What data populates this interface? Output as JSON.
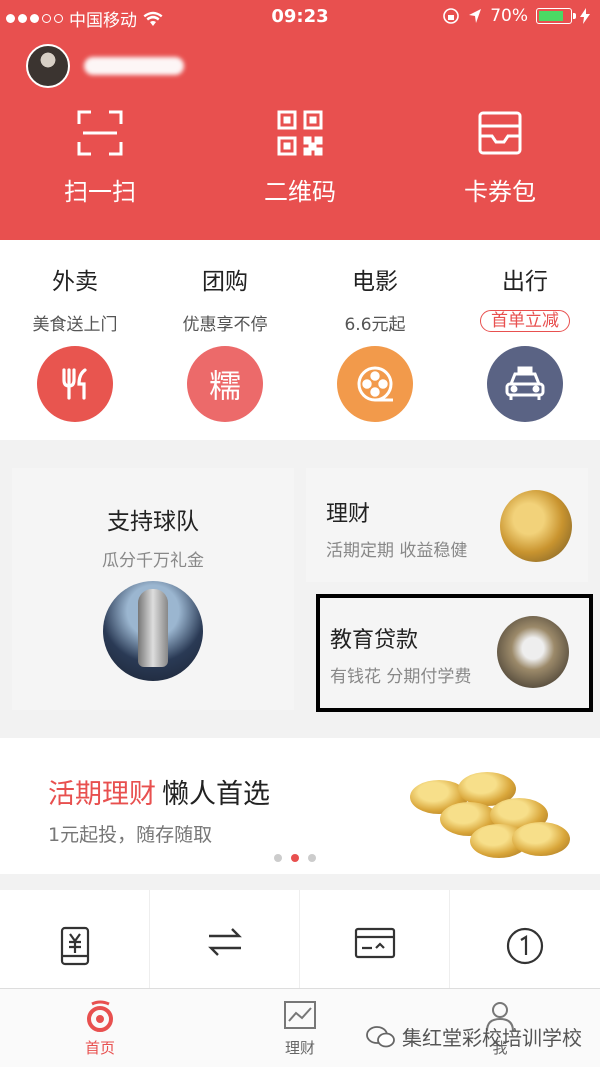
{
  "status_bar": {
    "carrier": "中国移动",
    "time": "09:23",
    "battery_percent": "70%"
  },
  "quick_actions": [
    {
      "label": "扫一扫",
      "icon": "scan-icon"
    },
    {
      "label": "二维码",
      "icon": "qrcode-icon"
    },
    {
      "label": "卡券包",
      "icon": "wallet-icon"
    }
  ],
  "categories": [
    {
      "title": "外卖",
      "subtitle": "美食送上门",
      "icon": "fork-knife-icon",
      "color": "#e8554f"
    },
    {
      "title": "团购",
      "subtitle": "优惠享不停",
      "icon": "nuo-icon",
      "icon_text": "糯",
      "color": "#ec6a6a"
    },
    {
      "title": "电影",
      "subtitle": "6.6元起",
      "icon": "film-reel-icon",
      "color": "#f29a4b"
    },
    {
      "title": "出行",
      "subtitle": "首单立减",
      "icon": "taxi-icon",
      "color": "#5a6384"
    }
  ],
  "promo": {
    "team": {
      "title": "支持球队",
      "subtitle": "瓜分千万礼金"
    },
    "finance": {
      "title": "理财",
      "subtitle": "活期定期 收益稳健"
    },
    "education": {
      "title": "教育贷款",
      "subtitle": "有钱花 分期付学费"
    }
  },
  "banner": {
    "highlight": "活期理财",
    "headline": "懒人首选",
    "subtext": "1元起投，随存随取"
  },
  "tabbar": {
    "home": "首页",
    "finance": "理财",
    "me": "我"
  },
  "watermark": "集红堂彩校培训学校",
  "colors": {
    "brand": "#e8504f"
  }
}
